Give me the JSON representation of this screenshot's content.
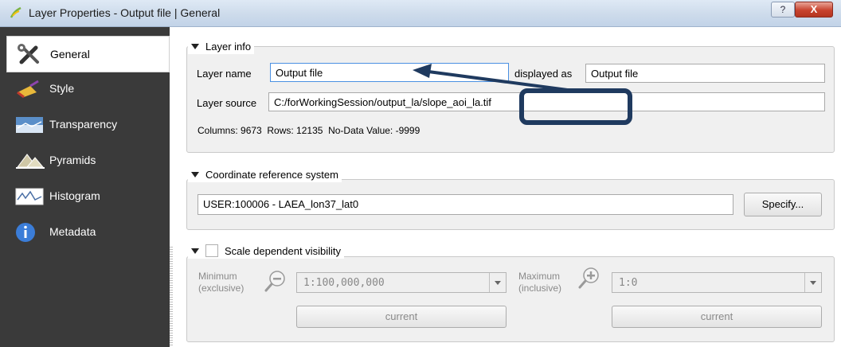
{
  "window": {
    "title": "Layer Properties - Output file | General",
    "help": "?",
    "close": "X"
  },
  "sidebar": {
    "items": [
      {
        "label": "General",
        "icon": "tools-icon"
      },
      {
        "label": "Style",
        "icon": "paintbrush-icon"
      },
      {
        "label": "Transparency",
        "icon": "transparency-icon"
      },
      {
        "label": "Pyramids",
        "icon": "pyramids-icon"
      },
      {
        "label": "Histogram",
        "icon": "histogram-icon"
      },
      {
        "label": "Metadata",
        "icon": "info-icon"
      }
    ]
  },
  "layer_info": {
    "heading": "Layer info",
    "layer_name_label": "Layer name",
    "layer_name_value": "Output file",
    "displayed_as_label": "displayed as",
    "displayed_as_value": "Output file",
    "layer_source_label": "Layer source",
    "layer_source_value": "C:/forWorkingSession/output_la/slope_aoi_la.tif",
    "stats": "Columns: 9673  Rows: 12135  No-Data Value: -9999"
  },
  "crs": {
    "heading": "Coordinate reference system",
    "value": "USER:100006 - LAEA_lon37_lat0",
    "specify_label": "Specify..."
  },
  "scale": {
    "heading": "Scale dependent visibility",
    "min_label_1": "Minimum",
    "min_label_2": "(exclusive)",
    "min_value": "1:100,000,000",
    "max_label_1": "Maximum",
    "max_label_2": "(inclusive)",
    "max_value": "1:0",
    "current_label": "current"
  },
  "colors": {
    "annotation": "#1f3a5f",
    "sidebar_bg": "#3a3a3a",
    "focus": "#4a90e2"
  }
}
